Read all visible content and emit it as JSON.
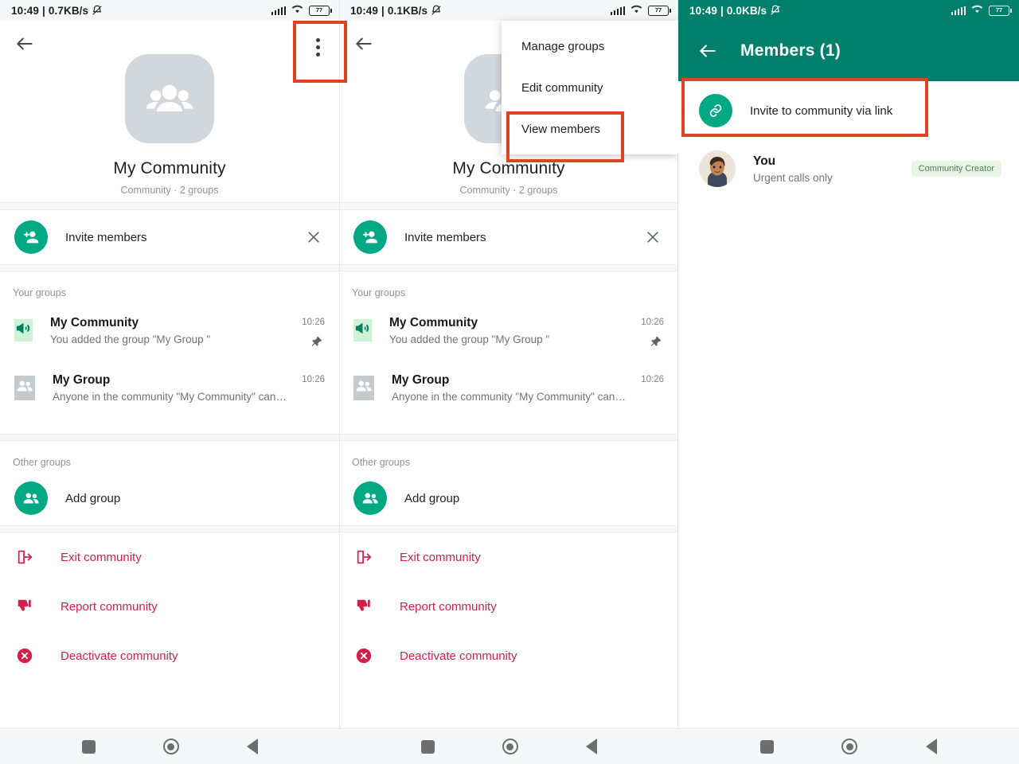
{
  "statusbars": {
    "panel1": {
      "time": "10:49",
      "separator": "|",
      "net_speed": "0.7KB/s",
      "battery": "77"
    },
    "panel2": {
      "time": "10:49",
      "separator": "|",
      "net_speed": "0.1KB/s",
      "battery": "77"
    },
    "panel3": {
      "time": "10:49",
      "separator": "|",
      "net_speed": "0.0KB/s",
      "battery": "77"
    }
  },
  "community": {
    "name": "My Community",
    "subtitle": "Community · 2 groups",
    "invite_row": {
      "label": "Invite members"
    },
    "your_groups_label": "Your groups",
    "other_groups_label": "Other groups",
    "groups": [
      {
        "title": "My Community",
        "preview": "You added the group \"My Group \"",
        "time": "10:26",
        "pinned": true,
        "icon": "announcement-icon"
      },
      {
        "title": "My Group",
        "preview": "Anyone in the community \"My Community\" can reques...",
        "time": "10:26",
        "pinned": false,
        "icon": "group-icon"
      }
    ],
    "add_group": {
      "label": "Add group"
    },
    "actions": [
      {
        "label": "Exit community",
        "icon": "exit-icon"
      },
      {
        "label": "Report community",
        "icon": "thumbs-down-icon"
      },
      {
        "label": "Deactivate community",
        "icon": "x-circle-icon"
      }
    ]
  },
  "overflow_menu": {
    "items": [
      {
        "label": "Manage groups"
      },
      {
        "label": "Edit community"
      },
      {
        "label": "View members"
      }
    ]
  },
  "members_screen": {
    "title": "Members (1)",
    "invite_link_label": "Invite to community via link",
    "members": [
      {
        "name": "You",
        "status": "Urgent calls only",
        "badge": "Community Creator"
      }
    ]
  },
  "navbar": {
    "recents_label": "Recents",
    "home_label": "Home",
    "back_label": "Back"
  },
  "colors": {
    "brand_green": "#00a884",
    "header_green": "#00806a",
    "danger_red": "#d3204a",
    "highlight_red": "#e04324",
    "badge_bg": "#e7f6e4"
  }
}
